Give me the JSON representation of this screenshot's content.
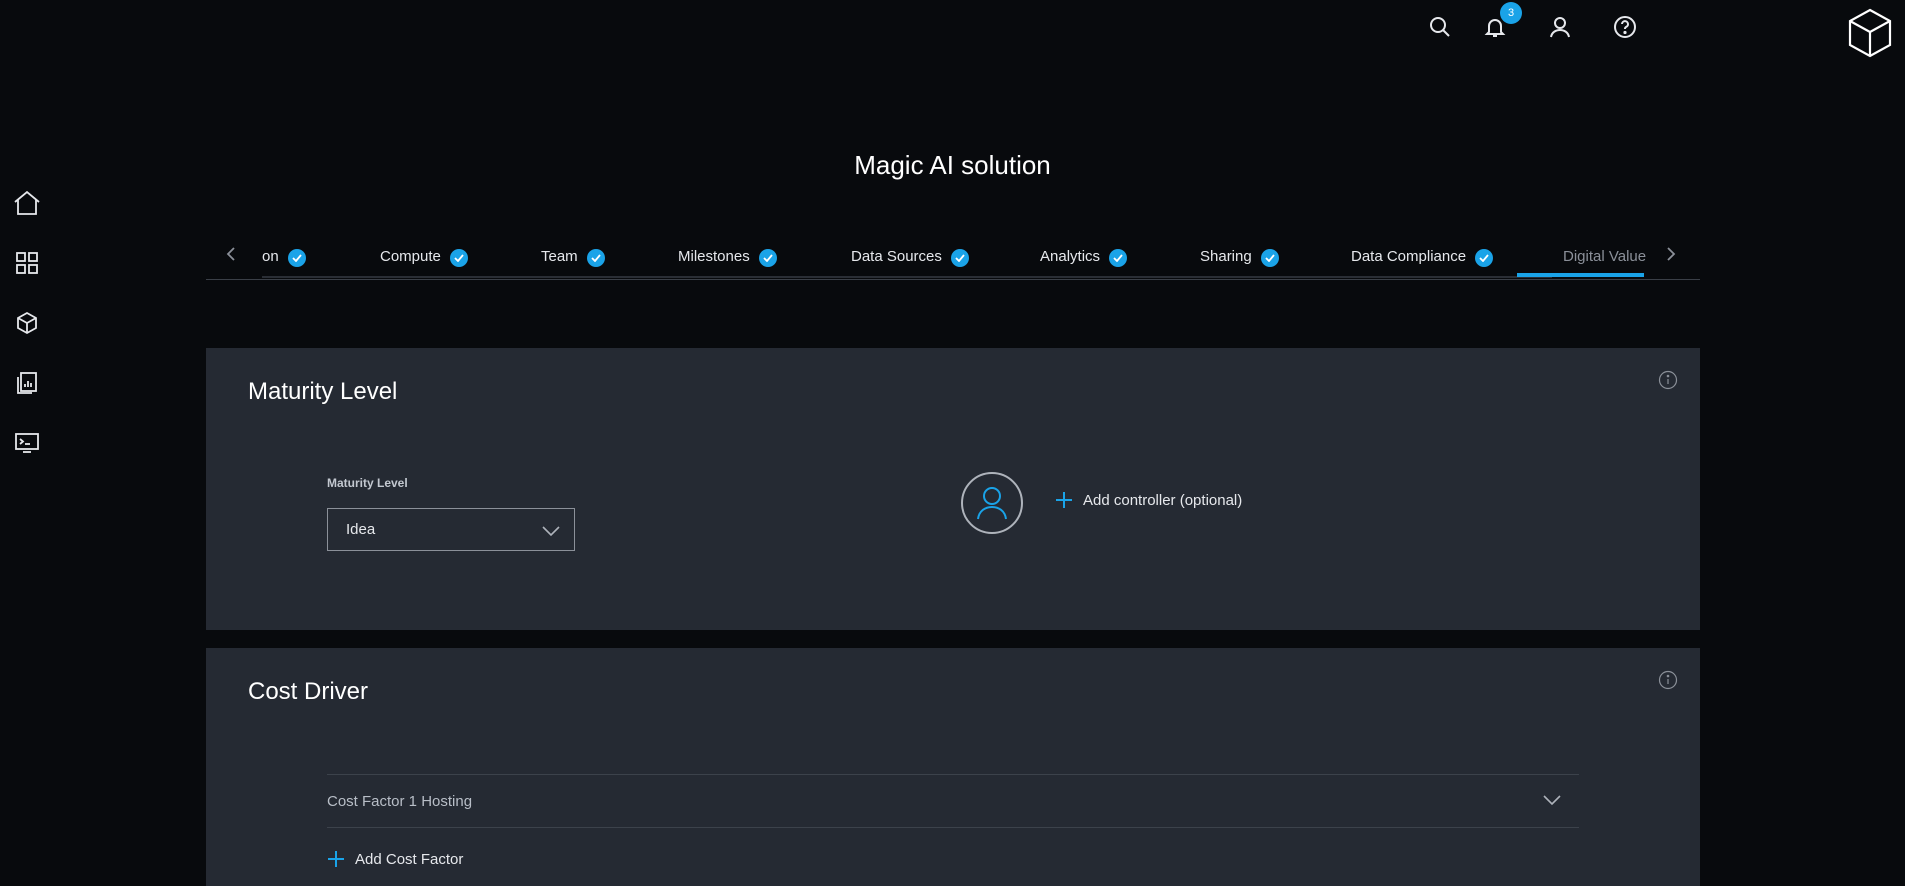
{
  "header": {
    "notification_count": "3",
    "icons": [
      "search-icon",
      "bell-icon",
      "user-icon",
      "help-icon",
      "cube-logo-icon"
    ]
  },
  "sidebar": {
    "icons": [
      "home-icon",
      "grid-icon",
      "cube-icon",
      "reports-icon",
      "terminal-icon"
    ]
  },
  "page": {
    "title": "Magic AI solution"
  },
  "tabs": [
    {
      "label": "on",
      "done": true
    },
    {
      "label": "Compute",
      "done": true
    },
    {
      "label": "Team",
      "done": true
    },
    {
      "label": "Milestones",
      "done": true
    },
    {
      "label": "Data Sources",
      "done": true
    },
    {
      "label": "Analytics",
      "done": true
    },
    {
      "label": "Sharing",
      "done": true
    },
    {
      "label": "Data Compliance",
      "done": true
    },
    {
      "label": "Digital Value",
      "done": false,
      "active": true
    }
  ],
  "maturity": {
    "title": "Maturity Level",
    "field_label": "Maturity Level",
    "selected": "Idea",
    "add_controller": "Add controller (optional)"
  },
  "cost": {
    "title": "Cost Driver",
    "factor": "Cost Factor 1 Hosting",
    "add_factor": "Add Cost Factor"
  },
  "colors": {
    "accent": "#1aa3e8",
    "background": "#080a0d",
    "card": "#252a33"
  }
}
